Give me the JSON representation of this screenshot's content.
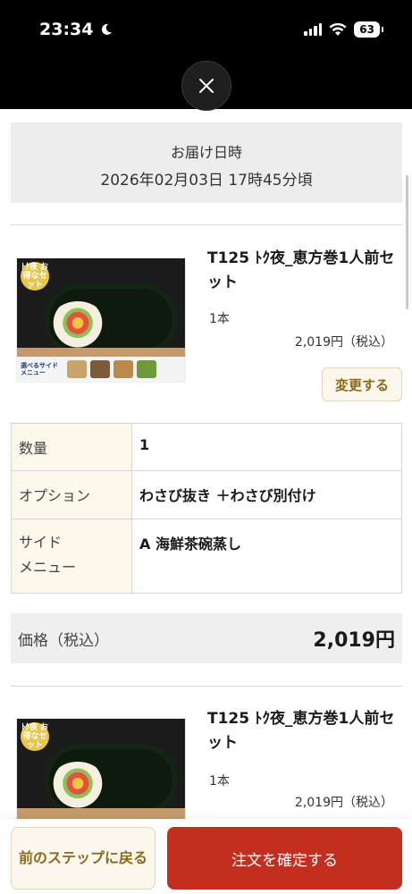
{
  "status_bar": {
    "time": "23:34",
    "battery": "63"
  },
  "delivery": {
    "label": "お届け日時",
    "datetime": "2026年02月03日 17時45分頃"
  },
  "products": [
    {
      "title": "T125 ﾄｸ夜_恵方巻1人前セット",
      "quantity": "1本",
      "price": "2,019円（税込）",
      "change_label": "変更する",
      "badge": "ﾄｸ夜 お得なセット",
      "side_tag": "選べるサイドメニュー"
    },
    {
      "title": "T125 ﾄｸ夜_恵方巻1人前セット",
      "quantity": "1本",
      "price": "2,019円（税込）",
      "badge": "ﾄｸ夜 お得なセット"
    }
  ],
  "spec": [
    {
      "key": "数量",
      "value": "1"
    },
    {
      "key": "オプション",
      "value": "わさび抜き ＋わさび別付け"
    },
    {
      "key": "サイド\nメニュー",
      "value": "A 海鮮茶碗蒸し"
    }
  ],
  "price_summary": {
    "label": "価格（税込）",
    "value": "2,019円"
  },
  "actions": {
    "back_label": "前のステップに戻る",
    "confirm_label": "注文を確定する"
  },
  "colors": {
    "accent": "#c42e1e",
    "gold_text": "#8a6a1e",
    "gold_bg": "#fbf7ec"
  },
  "icons": {
    "close": "close-icon",
    "moon": "moon-icon",
    "wifi": "wifi-icon",
    "signal": "signal-icon"
  }
}
